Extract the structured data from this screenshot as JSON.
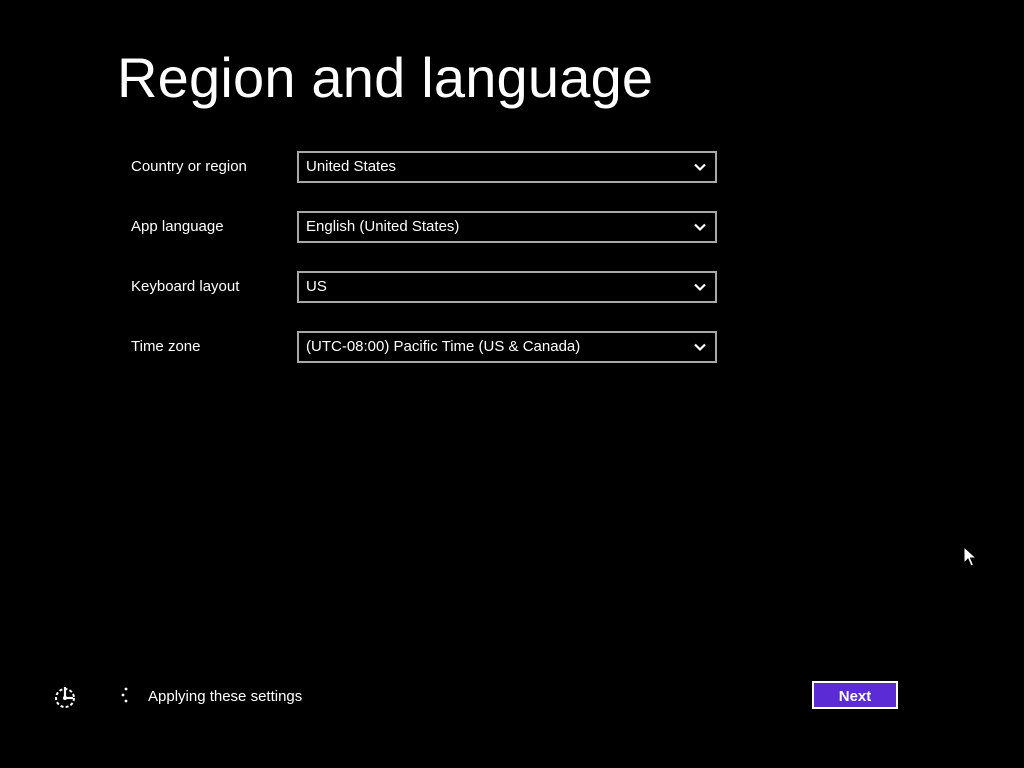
{
  "page": {
    "title": "Region and language"
  },
  "form": {
    "fields": [
      {
        "label": "Country or region",
        "value": "United States"
      },
      {
        "label": "App language",
        "value": "English (United States)"
      },
      {
        "label": "Keyboard layout",
        "value": "US"
      },
      {
        "label": "Time zone",
        "value": "(UTC-08:00) Pacific Time (US & Canada)"
      }
    ]
  },
  "footer": {
    "status_text": "Applying these settings",
    "accessibility_icon": "ease-of-access-icon",
    "spinner_icon": "loading-spinner-icon",
    "next_label": "Next"
  },
  "colors": {
    "background": "#000000",
    "text": "#ffffff",
    "select_border": "#a8a8a8",
    "accent": "#5b2bd6"
  }
}
